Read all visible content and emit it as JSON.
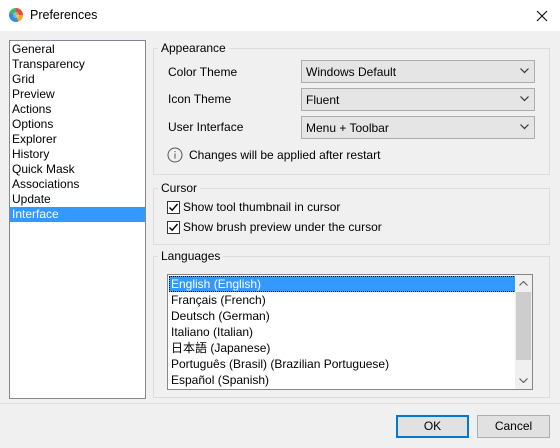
{
  "window": {
    "title": "Preferences"
  },
  "sidebar": {
    "items": [
      {
        "label": "General"
      },
      {
        "label": "Transparency"
      },
      {
        "label": "Grid"
      },
      {
        "label": "Preview"
      },
      {
        "label": "Actions"
      },
      {
        "label": "Options"
      },
      {
        "label": "Explorer"
      },
      {
        "label": "History"
      },
      {
        "label": "Quick Mask"
      },
      {
        "label": "Associations"
      },
      {
        "label": "Update"
      },
      {
        "label": "Interface",
        "selected": true
      }
    ]
  },
  "appearance": {
    "title": "Appearance",
    "color_theme": {
      "label": "Color Theme",
      "value": "Windows Default"
    },
    "icon_theme": {
      "label": "Icon Theme",
      "value": "Fluent"
    },
    "user_interface": {
      "label": "User Interface",
      "value": "Menu + Toolbar"
    },
    "restart_note": "Changes will be applied after restart"
  },
  "cursor": {
    "title": "Cursor",
    "show_tool_thumbnail": {
      "label": "Show tool thumbnail in cursor",
      "checked": true
    },
    "show_brush_preview": {
      "label": "Show brush preview under the cursor",
      "checked": true
    }
  },
  "languages": {
    "title": "Languages",
    "items": [
      {
        "label": "English (English)",
        "selected": true
      },
      {
        "label": "Français (French)"
      },
      {
        "label": "Deutsch (German)"
      },
      {
        "label": "Italiano (Italian)"
      },
      {
        "label": "日本語 (Japanese)"
      },
      {
        "label": "Português (Brasil) (Brazilian Portuguese)"
      },
      {
        "label": "Español (Spanish)"
      }
    ]
  },
  "buttons": {
    "ok": "OK",
    "cancel": "Cancel"
  },
  "colors": {
    "selection": "#3399ff",
    "dialog_bg": "#f0f0f0",
    "default_button_border": "#0078d7"
  }
}
